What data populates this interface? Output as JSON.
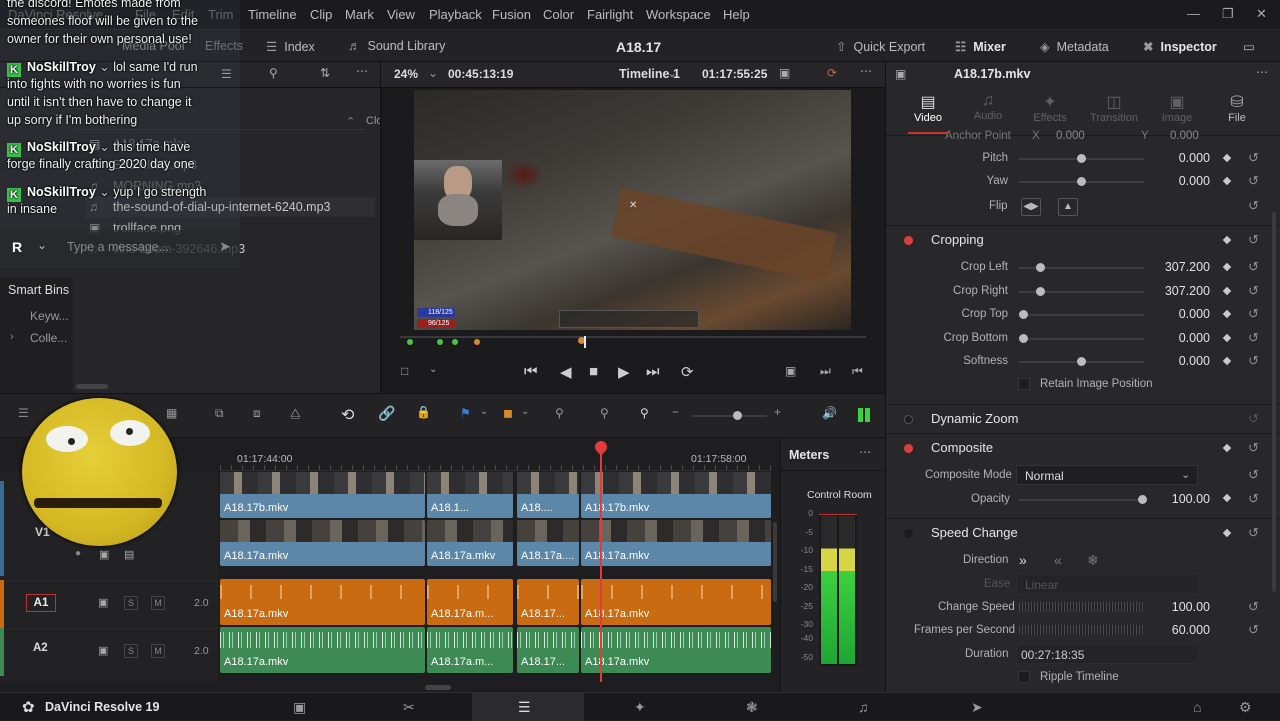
{
  "app": {
    "name": "DaVinci Resolve 19",
    "project_title": "A18.17",
    "menu": [
      "Timeline",
      "Clip",
      "Mark",
      "View",
      "Playback",
      "Fusion",
      "Color",
      "Fairlight",
      "Workspace",
      "Help"
    ],
    "menu_obscured": [
      "DaVinci Resolve",
      "File",
      "Edit",
      "Trim"
    ]
  },
  "toolbar": {
    "media_pool": "Media Pool",
    "effects": "Effects",
    "index": "Index",
    "sound_library": "Sound Library",
    "quick_export": "Quick Export",
    "mixer": "Mixer",
    "metadata": "Metadata",
    "inspector": "Inspector"
  },
  "media_pool": {
    "column_header": "Clo",
    "items": [
      {
        "name": "A18.17a.mkv",
        "icon": "film-icon"
      },
      {
        "name": "EVENING.mp3",
        "icon": "audio-file-icon"
      },
      {
        "name": "MORNING.mp3",
        "icon": "audio-file-icon"
      },
      {
        "name": "the-sound-of-dial-up-internet-6240.mp3",
        "icon": "audio-file-icon"
      },
      {
        "name": "trollface.png",
        "icon": "image-file-icon"
      },
      {
        "name": "vine-boom-392646.mp3",
        "icon": "audio-file-icon"
      }
    ],
    "smart_bins": "Smart Bins",
    "bins": [
      "Keyw...",
      "Colle..."
    ]
  },
  "chat_overlay": {
    "lines": [
      {
        "user": "",
        "text": "the discord! Emotes made from"
      },
      {
        "user": "",
        "text": "someones floof will be given to the"
      },
      {
        "user": "",
        "text": "owner for their own personal use!"
      },
      {
        "user": "NoSkillTroy",
        "text": "lol same I'd run"
      },
      {
        "user": "",
        "text": "into fights with no worries is fun"
      },
      {
        "user": "",
        "text": "until it isn't then have to change it"
      },
      {
        "user": "",
        "text": "up sorry if I'm bothering"
      },
      {
        "user": "NoSkillTroy",
        "text": "this time have"
      },
      {
        "user": "",
        "text": "forge finally crafting 2020 day one"
      },
      {
        "user": "NoSkillTroy",
        "text": "yup I go strength"
      },
      {
        "user": "",
        "text": "in insane"
      }
    ],
    "input_placeholder": "Type a message...",
    "avatar_letter": "R"
  },
  "viewer": {
    "zoom": "24%",
    "source_tc": "00:45:13:19",
    "timeline_name": "Timeline 1",
    "record_tc": "01:17:55:25"
  },
  "inspector": {
    "clip_name": "A18.17b.mkv",
    "tabs": [
      "Video",
      "Audio",
      "Effects",
      "Transition",
      "Image",
      "File"
    ],
    "active_tab": "Video",
    "partial_row": {
      "label": "Anchor Point",
      "x_label": "X",
      "x_value": "0.000",
      "y_label": "Y",
      "y_value": "0.000"
    },
    "transform_rows": [
      {
        "label": "Pitch",
        "value": "0.000",
        "knob": 0.5
      },
      {
        "label": "Yaw",
        "value": "0.000",
        "knob": 0.5
      }
    ],
    "flip_label": "Flip",
    "cropping": {
      "title": "Cropping",
      "rows": [
        {
          "label": "Crop Left",
          "value": "307.200",
          "knob": 0.15
        },
        {
          "label": "Crop Right",
          "value": "307.200",
          "knob": 0.15
        },
        {
          "label": "Crop Top",
          "value": "0.000",
          "knob": 0.0
        },
        {
          "label": "Crop Bottom",
          "value": "0.000",
          "knob": 0.0
        },
        {
          "label": "Softness",
          "value": "0.000",
          "knob": 0.5
        }
      ],
      "retain": "Retain Image Position"
    },
    "dynamic_zoom": "Dynamic Zoom",
    "composite": {
      "title": "Composite",
      "mode_label": "Composite Mode",
      "mode_value": "Normal",
      "opacity_label": "Opacity",
      "opacity_value": "100.00"
    },
    "speed_change": {
      "title": "Speed Change",
      "direction_label": "Direction",
      "ease_label": "Ease",
      "ease_value": "Linear",
      "change_speed_label": "Change Speed",
      "change_speed_value": "100.00",
      "fps_label": "Frames per Second",
      "fps_value": "60.000",
      "duration_label": "Duration",
      "duration_value": "00:27:18:35",
      "ripple": "Ripple Timeline"
    }
  },
  "timeline": {
    "ruler": [
      "01:17:44:00",
      "01:17:58:00"
    ],
    "tracks": {
      "v1": "V1",
      "a1": "A1",
      "a2": "A2",
      "a1_level": "2.0",
      "a2_level": "2.0",
      "solo": "S",
      "mute": "M"
    },
    "v2_clips": [
      "A18.17b.mkv",
      "A18.1...",
      "A18....",
      "A18.17b.mkv"
    ],
    "v1_clips": [
      "A18.17a.mkv",
      "A18.17a.mkv",
      "A18.17a....",
      "A18.17a.mkv"
    ],
    "a1_clips": [
      "A18.17a.mkv",
      "A18.17a.m...",
      "A18.17...",
      "A18.17a.mkv"
    ],
    "a2_clips": [
      "A18.17a.mkv",
      "A18.17a.m...",
      "A18.17...",
      "A18.17a.mkv"
    ]
  },
  "meters": {
    "title": "Meters",
    "control_room": "Control Room",
    "scale": [
      "0",
      "-5",
      "-10",
      "-15",
      "-20",
      "-25",
      "-30",
      "-40",
      "-50"
    ],
    "level": 0.78
  },
  "hud": {
    "health": "118/125",
    "stamina": "96/125"
  }
}
